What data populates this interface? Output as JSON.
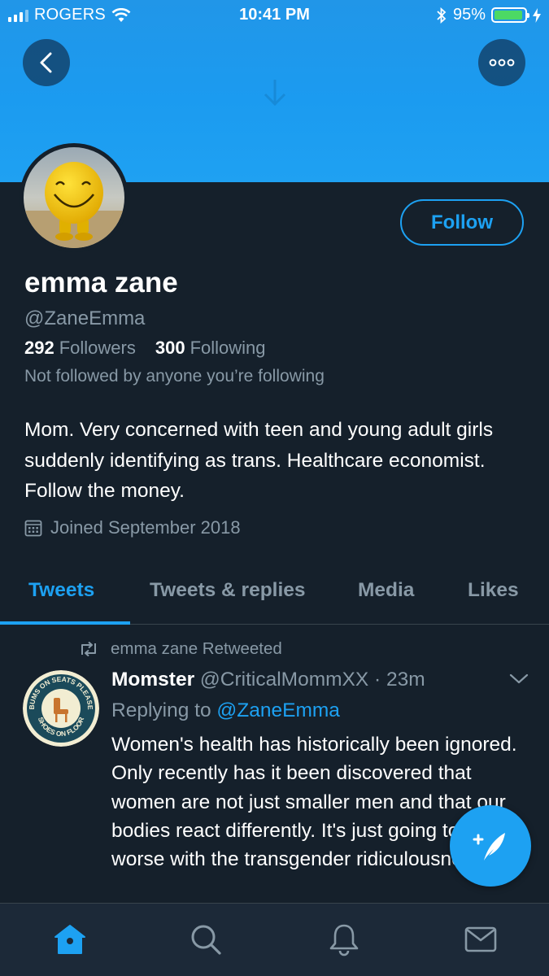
{
  "status_bar": {
    "carrier": "ROGERS",
    "time": "10:41 PM",
    "battery": "95%",
    "battery_level": 0.95
  },
  "header": {
    "banner_color": "#1da1f2",
    "back_icon": "chevron-left-icon",
    "more_icon": "more-horizontal-icon"
  },
  "profile": {
    "name": "emma zane",
    "handle": "@ZaneEmma",
    "followers_count": "292",
    "followers_label": "Followers",
    "following_count": "300",
    "following_label": "Following",
    "not_followed_text": "Not followed by anyone you’re following",
    "bio": "Mom. Very concerned with teen and young adult girls suddenly identifying as trans. Healthcare economist. Follow the money.",
    "joined": "Joined September 2018",
    "follow_label": "Follow"
  },
  "tabs": [
    {
      "label": "Tweets",
      "active": true
    },
    {
      "label": "Tweets & replies",
      "active": false
    },
    {
      "label": "Media",
      "active": false
    },
    {
      "label": "Likes",
      "active": false
    }
  ],
  "tweet": {
    "retweeted_by": "emma zane Retweeted",
    "author_name": "Momster",
    "author_handle": "@CriticalMommXX",
    "separator": " · ",
    "time_ago": "23m",
    "replying_prefix": "Replying to ",
    "replying_to": "@ZaneEmma",
    "text": "Women's health has historically been ignored. Only recently has it been discovered that women are not just smaller men and that our bodies react differently.   It's just going to get worse with the transgender ridiculousness.  We",
    "avatar_text_top": "BUMS ON SEATS PLEASE",
    "avatar_text_bottom": "SHOES ON FLOOR"
  },
  "bottom_nav": [
    {
      "icon": "home-icon",
      "active": true
    },
    {
      "icon": "search-icon",
      "active": false
    },
    {
      "icon": "bell-icon",
      "active": false
    },
    {
      "icon": "mail-icon",
      "active": false
    }
  ],
  "colors": {
    "background": "#15202b",
    "accent": "#1da1f2",
    "secondary_text": "#8899a6",
    "nav_background": "#1c2938"
  }
}
